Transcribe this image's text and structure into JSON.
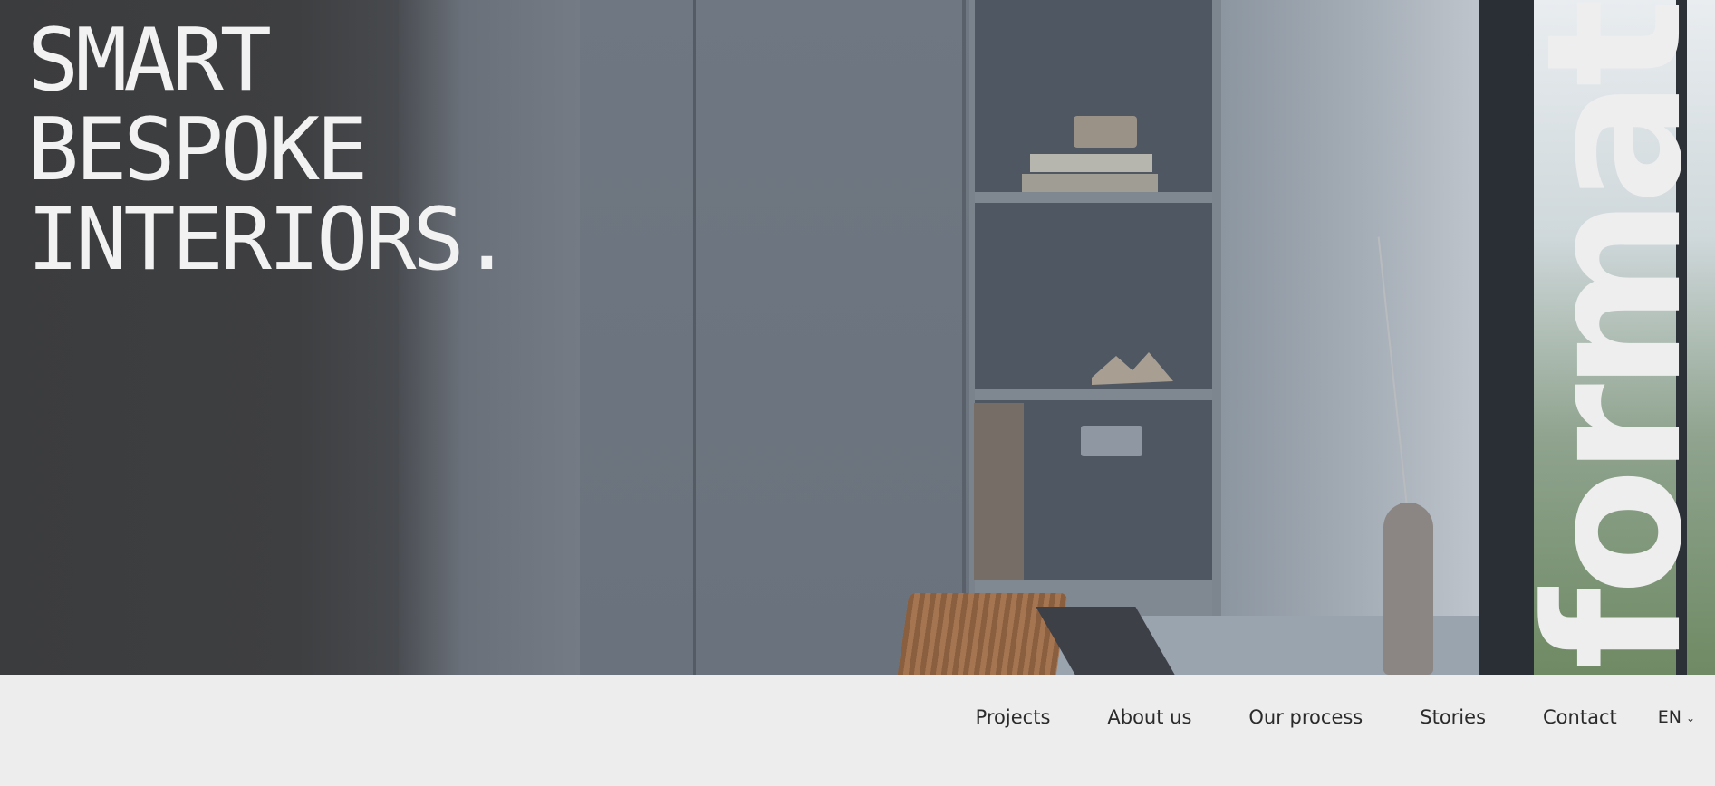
{
  "hero": {
    "headline": [
      "SMART",
      "BESPOKE",
      "INTERIORS."
    ]
  },
  "logo": {
    "text": "format"
  },
  "nav": {
    "items": [
      "Projects",
      "About us",
      "Our process",
      "Stories",
      "Contact"
    ],
    "language": "EN",
    "language_icon": "chevron-down-icon"
  },
  "colors": {
    "background": "#ededed",
    "headline": "#f2f2f2",
    "nav_text": "#2b2b2b"
  }
}
